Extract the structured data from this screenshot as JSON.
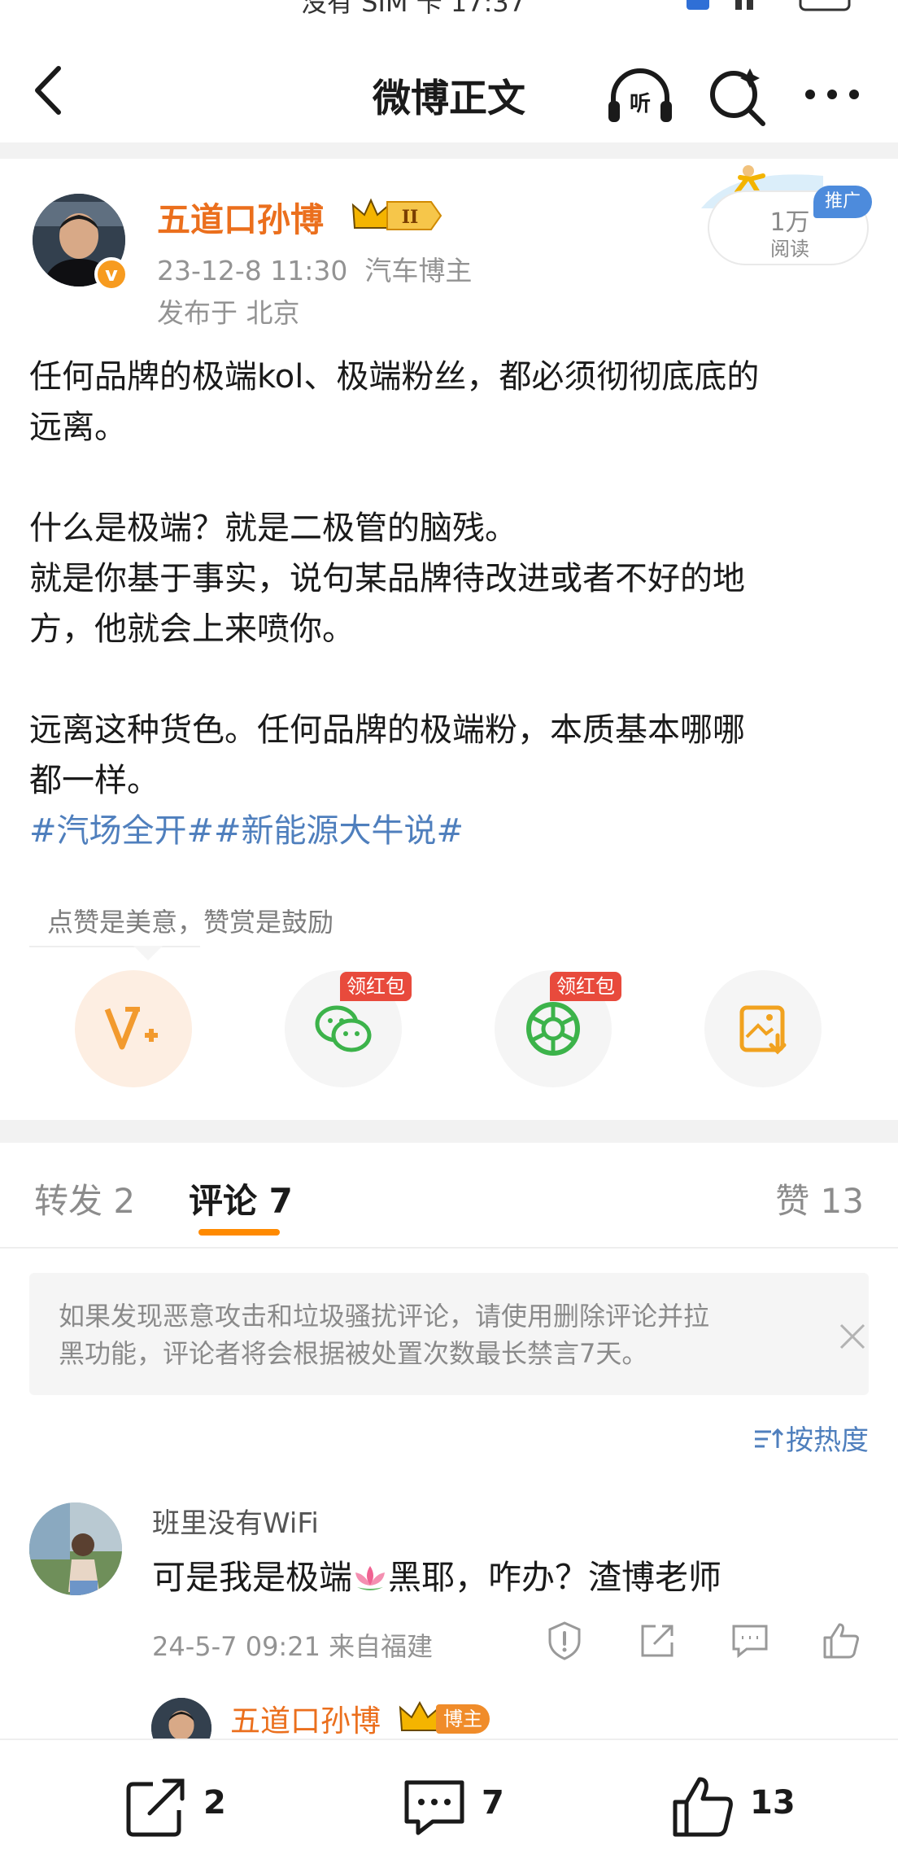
{
  "status_bar": {
    "text": "没有 SIM 卡 17:37"
  },
  "nav": {
    "title": "微博正文"
  },
  "post": {
    "author": "五道口孙博",
    "vip_level": "II",
    "date": "23-12-8 11:30",
    "role": "汽车博主",
    "location": "发布于 北京",
    "reads": "1万",
    "reads_label": "阅读",
    "promo_badge": "推广",
    "lines": {
      "l1": "任何品牌的极端kol、极端粉丝，都必须彻彻底底的",
      "l2": "远离。",
      "l3": "什么是极端？就是二极管的脑残。",
      "l4": "就是你基于事实，说句某品牌待改进或者不好的地",
      "l5": "方，他就会上来喷你。",
      "l6": "远离这种货色。任何品牌的极端粉，本质基本哪哪",
      "l7": "都一样。"
    },
    "hashtags": [
      "#汽场全开#",
      "#新能源大牛说#"
    ]
  },
  "reward": {
    "tip": "点赞是美意，赞赏是鼓励",
    "hongbao_label": "领红包"
  },
  "tabs": {
    "repost": "转发 2",
    "comment": "评论 7",
    "like": "赞 13"
  },
  "notice": {
    "text": "如果发现恶意攻击和垃圾骚扰评论，请使用删除评论并拉\n黑功能，评论者将会根据被处置次数最长禁言7天。"
  },
  "sort": {
    "label": "按热度"
  },
  "comment": {
    "user": "班里没有WiFi",
    "text_before": "可是我是极端",
    "text_after": "黑耶，咋办？渣博老师",
    "meta": "24-5-7 09:21  来自福建"
  },
  "reply": {
    "name": "五道口孙博",
    "badge": "博主"
  },
  "bottom_bar": {
    "repost_count": "2",
    "comment_count": "7",
    "like_count": "13"
  },
  "colors": {
    "accent_orange": "#ff8a00",
    "author_orange": "#eb6f1d",
    "link_blue": "#4f7fbd",
    "hongbao_red": "#e84a3c"
  }
}
